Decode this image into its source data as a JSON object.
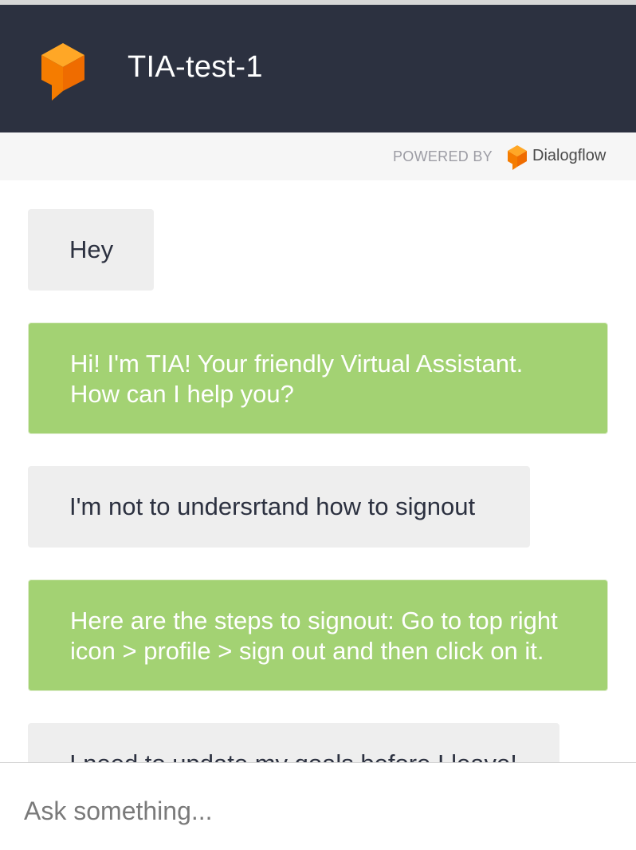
{
  "header": {
    "title": "TIA-test-1",
    "logo_icon": "dialogflow-cube-icon",
    "background": "#2c3140"
  },
  "powered_by": {
    "label": "POWERED BY",
    "brand_name": "Dialogflow",
    "brand_icon": "dialogflow-cube-icon"
  },
  "colors": {
    "brand_orange": "#f7931e",
    "bot_bubble": "#a3d273",
    "user_bubble": "#eeeeee"
  },
  "messages": [
    {
      "sender": "user",
      "text": "Hey"
    },
    {
      "sender": "bot",
      "text": "Hi! I'm TIA! Your friendly Virtual Assistant. How can I help you?"
    },
    {
      "sender": "user",
      "text": "I'm not to undersrtand how to signout"
    },
    {
      "sender": "bot",
      "text": "Here are the steps to signout: Go to top right icon > profile > sign out and then click on it."
    },
    {
      "sender": "user",
      "text": "I need to update my goals before I leave!"
    }
  ],
  "composer": {
    "placeholder": "Ask something..."
  }
}
